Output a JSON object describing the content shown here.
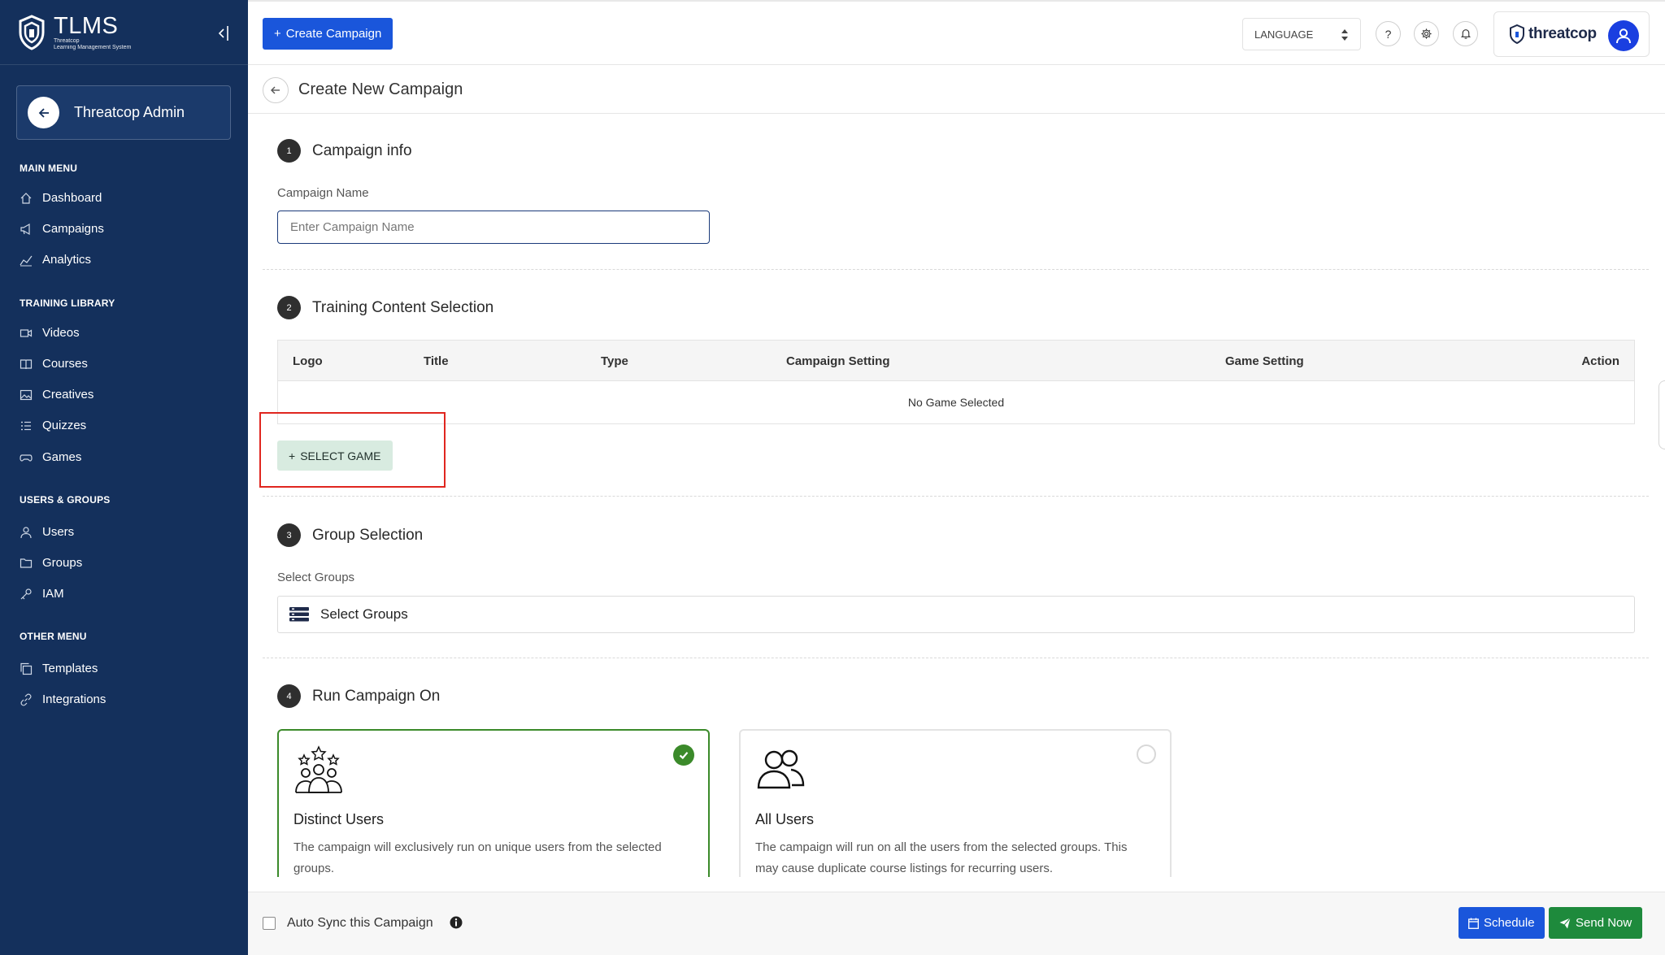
{
  "colors": {
    "sidebar_bg": "#14305c",
    "primary": "#1a56db",
    "success": "#1e8a3c",
    "selected_border": "#3b8a2a",
    "highlight": "#e0261f",
    "select_game_bg": "#d8ebe0"
  },
  "app": {
    "brand_title": "TLMS",
    "brand_subtitle_line1": "Threatcop",
    "brand_subtitle_line2": "Learning Management System",
    "collapse_icon": "collapse-sidebar-icon"
  },
  "admin": {
    "name": "Threatcop Admin",
    "back_icon": "arrow-left-icon"
  },
  "sidebar": {
    "sections": [
      {
        "title": "MAIN MENU",
        "items": [
          {
            "label": "Dashboard",
            "icon": "home-icon"
          },
          {
            "label": "Campaigns",
            "icon": "megaphone-icon"
          },
          {
            "label": "Analytics",
            "icon": "chart-line-icon"
          }
        ]
      },
      {
        "title": "TRAINING LIBRARY",
        "items": [
          {
            "label": "Videos",
            "icon": "video-icon"
          },
          {
            "label": "Courses",
            "icon": "book-icon"
          },
          {
            "label": "Creatives",
            "icon": "image-icon"
          },
          {
            "label": "Quizzes",
            "icon": "list-icon"
          },
          {
            "label": "Games",
            "icon": "gamepad-icon"
          }
        ]
      },
      {
        "title": "USERS & GROUPS",
        "items": [
          {
            "label": "Users",
            "icon": "user-icon"
          },
          {
            "label": "Groups",
            "icon": "folder-icon"
          },
          {
            "label": "IAM",
            "icon": "key-icon"
          }
        ]
      },
      {
        "title": "OTHER MENU",
        "items": [
          {
            "label": "Templates",
            "icon": "copy-icon"
          },
          {
            "label": "Integrations",
            "icon": "link-icon"
          }
        ]
      }
    ]
  },
  "topbar": {
    "create_label": "Create Campaign",
    "language_label": "LANGUAGE",
    "help_icon": "question-icon",
    "settings_icon": "gear-icon",
    "notification_icon": "bell-icon",
    "company_logo_text": "threatcop",
    "avatar_icon": "user-avatar-icon"
  },
  "page": {
    "title": "Create New Campaign"
  },
  "steps": {
    "one": {
      "number": "1",
      "title": "Campaign info",
      "field_label": "Campaign Name",
      "placeholder": "Enter Campaign Name",
      "value": ""
    },
    "two": {
      "number": "2",
      "title": "Training Content Selection",
      "columns": [
        "Logo",
        "Title",
        "Type",
        "Campaign Setting",
        "Game Setting",
        "Action"
      ],
      "empty_text": "No Game Selected",
      "select_game_label": "SELECT GAME"
    },
    "three": {
      "number": "3",
      "title": "Group Selection",
      "field_label": "Select Groups",
      "select_label": "Select Groups"
    },
    "four": {
      "number": "4",
      "title": "Run Campaign On",
      "options": [
        {
          "title": "Distinct Users",
          "description": "The campaign will exclusively run on unique users from the selected groups.",
          "selected": true,
          "icon": "distinct-users-icon"
        },
        {
          "title": "All Users",
          "description": "The campaign will run on all the users from the selected groups. This may cause duplicate course listings for recurring users.",
          "selected": false,
          "icon": "all-users-icon"
        }
      ]
    }
  },
  "footer": {
    "auto_sync_label": "Auto Sync this Campaign",
    "auto_sync_checked": false,
    "schedule_label": "Schedule",
    "send_label": "Send Now"
  }
}
